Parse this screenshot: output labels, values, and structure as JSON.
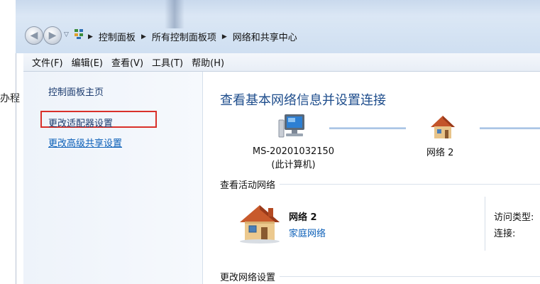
{
  "background": {
    "text": "办程"
  },
  "nav": {
    "back_icon": "back-arrow-icon",
    "forward_icon": "forward-arrow-icon",
    "breadcrumb": [
      "控制面板",
      "所有控制面板项",
      "网络和共享中心"
    ]
  },
  "menu": [
    "文件(F)",
    "编辑(E)",
    "查看(V)",
    "工具(T)",
    "帮助(H)"
  ],
  "sidebar": {
    "home": "控制面板主页",
    "links": [
      "更改适配器设置",
      "更改高级共享设置"
    ]
  },
  "main": {
    "title": "查看基本网络信息并设置连接",
    "computer": {
      "name": "MS-20201032150",
      "note": "(此计算机)"
    },
    "network_top": "网络 2",
    "active_section": "查看活动网络",
    "active": {
      "name": "网络 2",
      "type": "家庭网络"
    },
    "access_label": "访问类型:",
    "connect_label": "连接:",
    "change_section": "更改网络设置"
  },
  "colors": {
    "highlight_box": "#d9302a",
    "link": "#0b5fb8",
    "title": "#1e4d8c"
  }
}
